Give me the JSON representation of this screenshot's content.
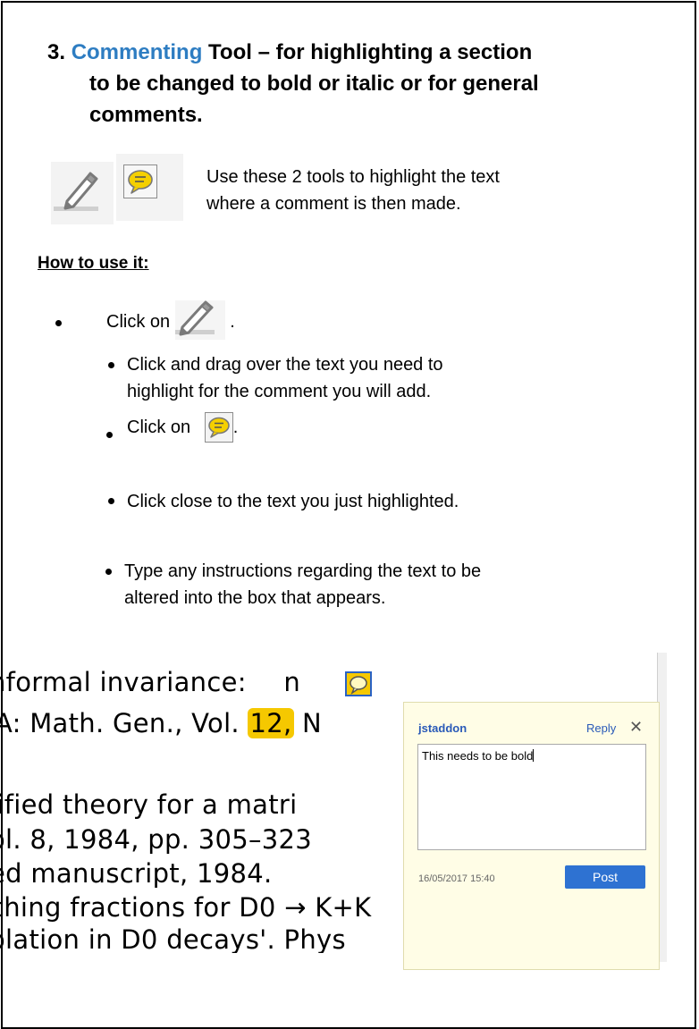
{
  "heading": {
    "number": "3.",
    "accent": "Commenting",
    "line1_rest": "Tool – for highlighting a section",
    "line2": "to be changed to bold or italic or for general",
    "line3": "comments."
  },
  "intro": {
    "line1": "Use these 2 tools to highlight the text",
    "line2": "where a comment is then made."
  },
  "howto_title": "How to use it:",
  "steps": {
    "s1_text": "Click on",
    "s1_tail": ".",
    "s2_line1": "Click and drag over the text you need to",
    "s2_line2": "highlight for the comment you will add.",
    "s3_text": "Click on",
    "s3_tail": ".",
    "s4": "Click close to the text you just highlighted.",
    "s5_line1": "Type any instructions regarding the text to be",
    "s5_line2": "altered into the box that appears."
  },
  "document": {
    "line1": "nformal invariance:",
    "line1_tail": "n",
    "line2_pre": "A: Math. Gen., Vol.",
    "line2_highlight": "12,",
    "line2_tail": "N",
    "line3": "lified theory for a matri",
    "line4": "ol. 8, 1984, pp. 305–323",
    "line5": "ed manuscript, 1984.",
    "line6": "ching fractions for D0 → K+K",
    "line7": "olation in D0 decays'. Phys"
  },
  "popup": {
    "user": "jstaddon",
    "reply": "Reply",
    "close": "✕",
    "comment": "This needs to be bold",
    "timestamp": "16/05/2017  15:40",
    "post": "Post"
  },
  "colors": {
    "accent": "#2e7dc2",
    "highlight": "#f5c800",
    "post_button": "#2e72d2",
    "popup_bg": "#fffde6"
  },
  "icons": [
    "highlighter-pen-icon",
    "comment-bubble-icon"
  ]
}
